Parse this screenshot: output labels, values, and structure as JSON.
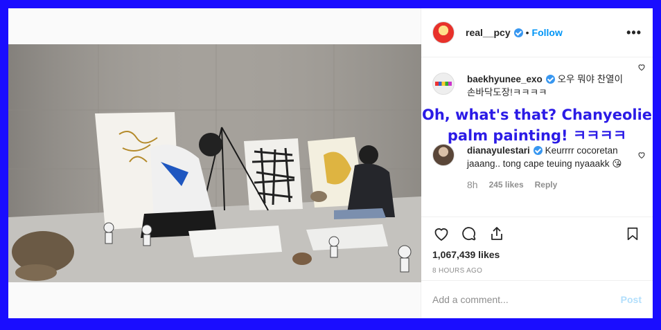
{
  "post": {
    "username": "real__pcy",
    "separator": "•",
    "follow_label": "Follow",
    "more_label": "•••"
  },
  "comments": [
    {
      "username": "baekhyunee_exo",
      "text": "오우 뭐야 찬열이 손바닥도장!ㅋㅋㅋㅋ",
      "translation_line1": "Oh, what's that? Chanyeolie",
      "translation_line2": "palm painting! ㅋㅋㅋㅋ"
    },
    {
      "username": "dianayulestari",
      "text": "Keurrrr cocoretan jaaang.. tong cape teuing nyaaakk 😘",
      "time": "8h",
      "likes": "245 likes",
      "reply_label": "Reply"
    }
  ],
  "actions": {
    "likes_count": "1,067,439 likes",
    "timestamp": "8 HOURS AGO"
  },
  "composer": {
    "placeholder": "Add a comment...",
    "post_label": "Post"
  },
  "colors": {
    "background_frame": "#1a0dff",
    "link_blue": "#0095f6",
    "translation_text": "#2b1be6",
    "verified_badge": "#3897f0"
  }
}
